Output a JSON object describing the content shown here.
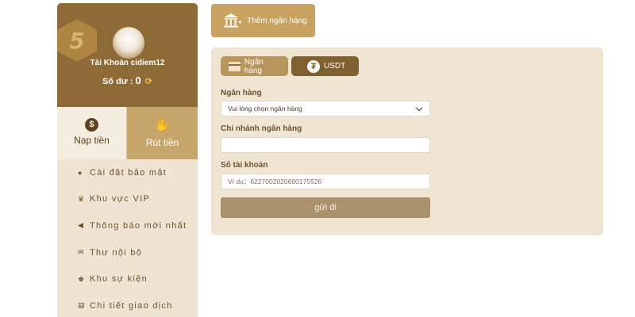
{
  "sidebar": {
    "logo_text": "5",
    "account_label": "Tài Khoản cidiem12",
    "balance_label": "Số dư :",
    "balance_value": "0",
    "tabs": [
      {
        "label": "Nạp tiền",
        "icon": "money-bag-icon"
      },
      {
        "label": "Rút tiền",
        "icon": "hand-money-icon"
      }
    ],
    "menu": [
      {
        "label": "Cài đặt bảo mật",
        "icon": "user-lock-icon"
      },
      {
        "label": "Khu vực VIP",
        "icon": "vip-crown-icon"
      },
      {
        "label": "Thông báo mới nhất",
        "icon": "megaphone-icon"
      },
      {
        "label": "Thư nội bộ",
        "icon": "envelope-icon"
      },
      {
        "label": "Khu sự kiện",
        "icon": "trophy-icon"
      },
      {
        "label": "Chi tiết giao dịch",
        "icon": "receipt-icon"
      }
    ]
  },
  "toolbar": {
    "add_bank_label": "Thêm ngân hàng"
  },
  "panel": {
    "tabs": [
      {
        "label": "Ngân hàng",
        "icon": "card-icon"
      },
      {
        "label": "USDT",
        "icon": "tether-icon"
      }
    ],
    "bank_label": "Ngân hàng",
    "bank_select_value": "Vui lòng chọn ngân hàng",
    "branch_label": "Chi nhánh ngân hàng",
    "branch_value": "",
    "account_number_label": "Số tài khoản",
    "account_number_placeholder": "Ví dụ：6227002020690175526",
    "submit_label": "gửi đi"
  },
  "colors": {
    "brand_dark": "#8d6a36",
    "brand_gold": "#c9a261",
    "panel_bg": "#f0e5d3"
  }
}
